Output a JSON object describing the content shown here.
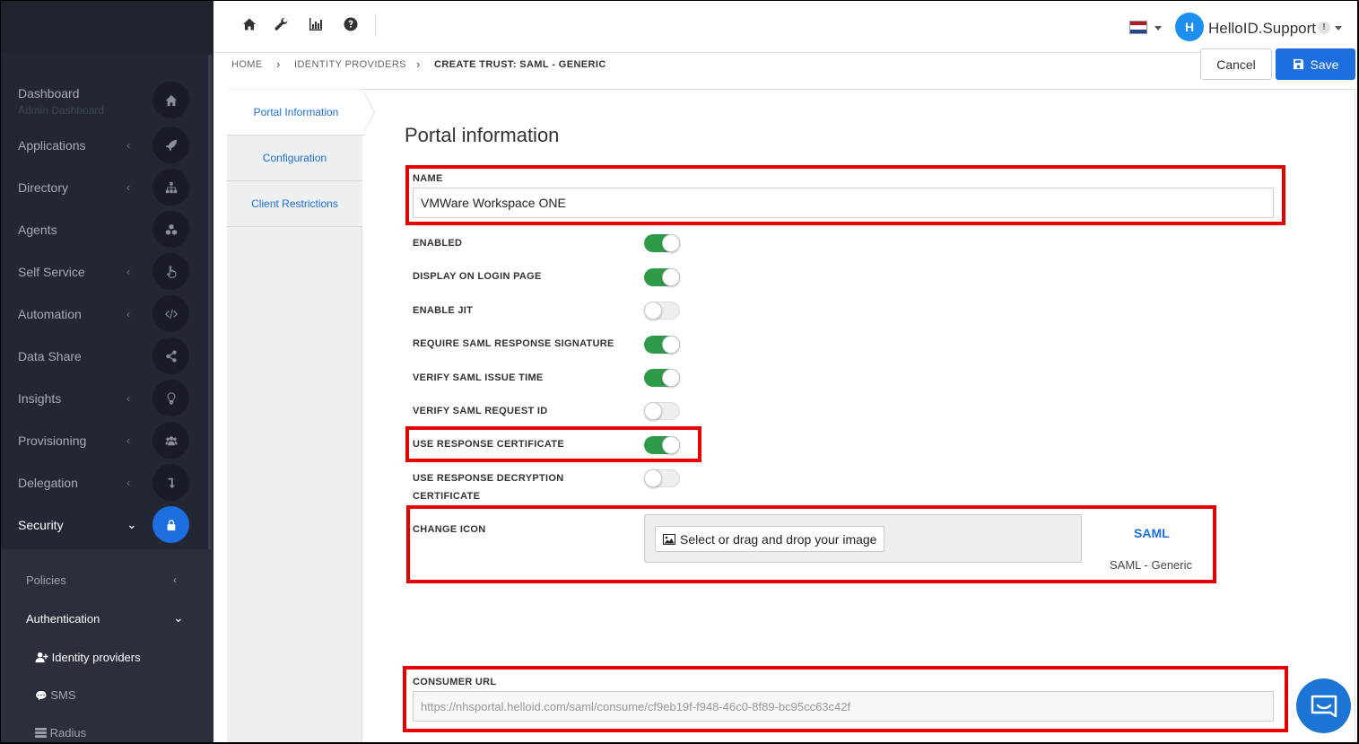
{
  "sidebar": {
    "dashboard": {
      "label": "Dashboard",
      "sub": "Admin Dashboard"
    },
    "items": [
      {
        "label": "Applications"
      },
      {
        "label": "Directory"
      },
      {
        "label": "Agents"
      },
      {
        "label": "Self Service"
      },
      {
        "label": "Automation"
      },
      {
        "label": "Data Share"
      },
      {
        "label": "Insights"
      },
      {
        "label": "Provisioning"
      },
      {
        "label": "Delegation"
      },
      {
        "label": "Security"
      }
    ],
    "subnav": {
      "policies": "Policies",
      "authentication": "Authentication",
      "identity_providers": "Identity providers",
      "sms": "SMS",
      "radius": "Radius"
    }
  },
  "topbar": {
    "username": "HelloID.Support",
    "avatar_letter": "H",
    "badge": "!"
  },
  "breadcrumb": {
    "home": "HOME",
    "identity_providers": "IDENTITY PROVIDERS",
    "current": "CREATE TRUST: SAML - GENERIC"
  },
  "actions": {
    "cancel": "Cancel",
    "save": "Save"
  },
  "tabs": {
    "portal_information": "Portal Information",
    "configuration": "Configuration",
    "client_restrictions": "Client Restrictions"
  },
  "form": {
    "title": "Portal information",
    "name_label": "NAME",
    "name_value": "VMWare Workspace ONE",
    "toggles": [
      {
        "label": "ENABLED",
        "on": true
      },
      {
        "label": "DISPLAY ON LOGIN PAGE",
        "on": true
      },
      {
        "label": "ENABLE JIT",
        "on": false
      },
      {
        "label": "REQUIRE SAML RESPONSE SIGNATURE",
        "on": true
      },
      {
        "label": "VERIFY SAML ISSUE TIME",
        "on": true
      },
      {
        "label": "VERIFY SAML REQUEST ID",
        "on": false
      },
      {
        "label": "USE RESPONSE CERTIFICATE",
        "on": true
      },
      {
        "label_line1": "USE RESPONSE DECRYPTION",
        "label_line2": "CERTIFICATE",
        "on": false
      }
    ],
    "change_icon_label": "CHANGE ICON",
    "select_image": "Select or drag and drop your image",
    "icon_logo": "SAML",
    "icon_caption": "SAML - Generic",
    "consumer_url_label": "CONSUMER URL",
    "consumer_url_value": "https://nhsportal.helloid.com/saml/consume/cf9eb19f-f948-46c0-8f89-bc95cc63c42f"
  },
  "colors": {
    "accent": "#1d6fe0",
    "toggle_on": "#2e9b48",
    "highlight": "#e80000",
    "sidebar_bg": "#232734"
  }
}
